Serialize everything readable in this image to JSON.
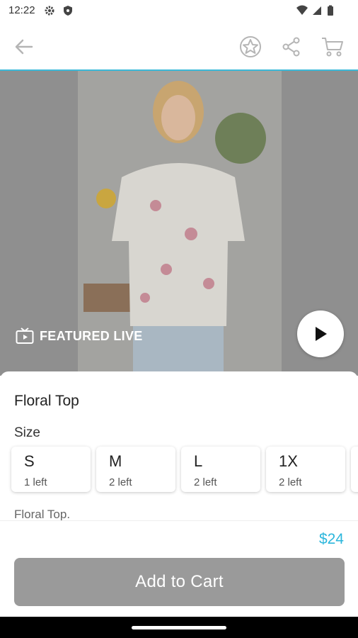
{
  "status": {
    "time": "12:22",
    "icons": [
      "settings-icon",
      "shield-icon",
      "wifi-icon",
      "signal-icon",
      "battery-icon"
    ]
  },
  "toolbar": {
    "back": "back-arrow-icon",
    "favorite": "star-icon",
    "share": "share-icon",
    "cart": "cart-icon"
  },
  "hero": {
    "badge_label": "FEATURED LIVE",
    "badge_icon": "tv-icon",
    "play_icon": "play-icon"
  },
  "product": {
    "title": "Floral Top",
    "size_label": "Size",
    "sizes": [
      {
        "size": "S",
        "count": "1 left"
      },
      {
        "size": "M",
        "count": "2 left"
      },
      {
        "size": "L",
        "count": "2 left"
      },
      {
        "size": "1X",
        "count": "2 left"
      }
    ],
    "description": "Floral Top."
  },
  "checkout": {
    "price": "$24",
    "button_label": "Add to Cart"
  },
  "colors": {
    "accent": "#3bb8d8",
    "price": "#2bb6dc",
    "button_disabled": "#9a9a9a"
  }
}
